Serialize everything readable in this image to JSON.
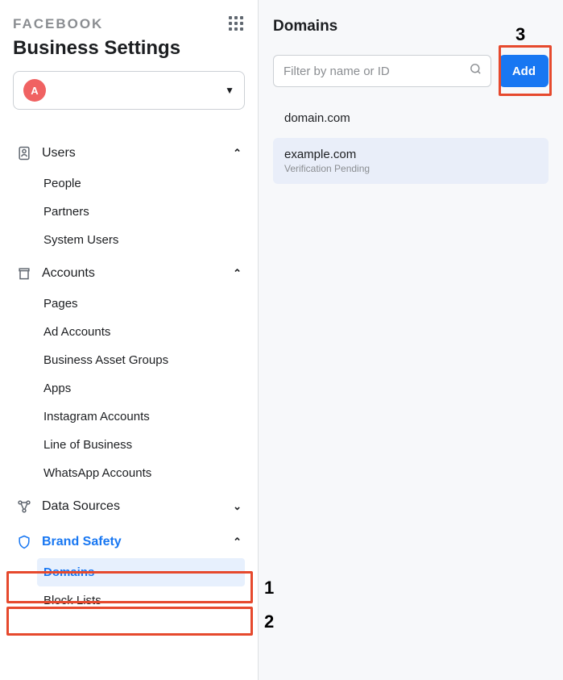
{
  "brand": "FACEBOOK",
  "title": "Business Settings",
  "account": {
    "initial": "A"
  },
  "nav": {
    "users": {
      "label": "Users",
      "items": [
        "People",
        "Partners",
        "System Users"
      ]
    },
    "accounts": {
      "label": "Accounts",
      "items": [
        "Pages",
        "Ad Accounts",
        "Business Asset Groups",
        "Apps",
        "Instagram Accounts",
        "Line of Business",
        "WhatsApp Accounts"
      ]
    },
    "data_sources": {
      "label": "Data Sources"
    },
    "brand_safety": {
      "label": "Brand Safety",
      "items": [
        "Domains",
        "Block Lists"
      ]
    }
  },
  "main": {
    "title": "Domains",
    "search_placeholder": "Filter by name or ID",
    "add_label": "Add",
    "domains": [
      {
        "name": "domain.com",
        "status": ""
      },
      {
        "name": "example.com",
        "status": "Verification Pending"
      }
    ]
  },
  "annotations": {
    "n1": "1",
    "n2": "2",
    "n3": "3"
  }
}
